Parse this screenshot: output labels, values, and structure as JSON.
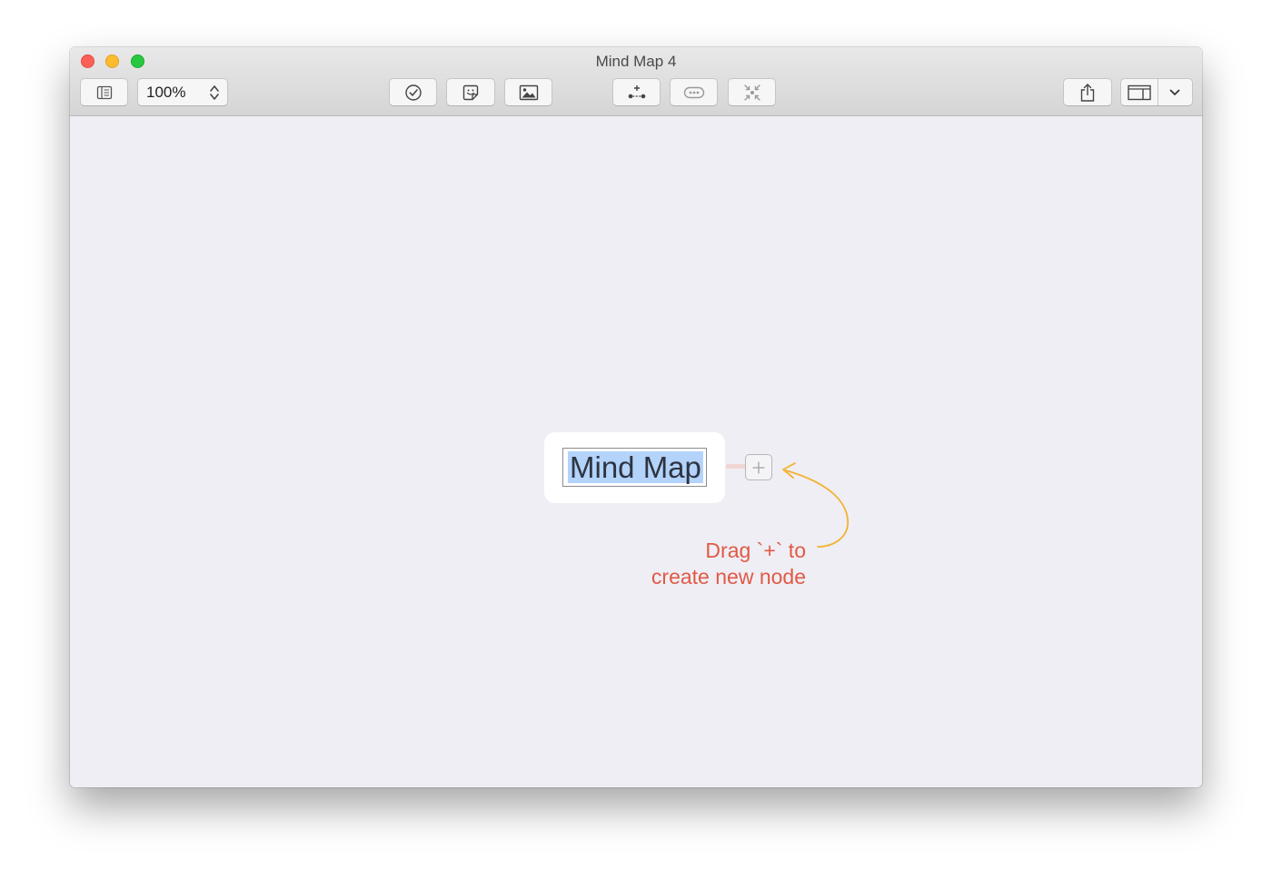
{
  "window": {
    "title": "Mind Map 4"
  },
  "toolbar": {
    "zoom": {
      "value": "100%"
    },
    "icons": {
      "sidebar": "sidebar-icon",
      "task": "checkmark-circle-icon",
      "sticker": "sticker-icon",
      "image": "image-icon",
      "add_child": "add-child-node-icon",
      "callout": "callout-icon",
      "collapse": "collapse-icon",
      "share": "share-icon",
      "inspector": "inspector-panel-icon",
      "dropdown": "chevron-down-icon"
    }
  },
  "canvas": {
    "root_node": {
      "text": "Mind Map"
    },
    "add_handle": {
      "icon": "plus-icon"
    },
    "annotation": {
      "line1": "Drag `+` to",
      "line2": "create new node"
    }
  },
  "colors": {
    "traffic_close": "#fc5f57",
    "traffic_min": "#fdbc2e",
    "traffic_max": "#28c840",
    "canvas_bg": "#efeef4",
    "selection": "#b3d3fb",
    "annotation_text": "#e05a45",
    "annotation_arrow": "#f2b233"
  }
}
